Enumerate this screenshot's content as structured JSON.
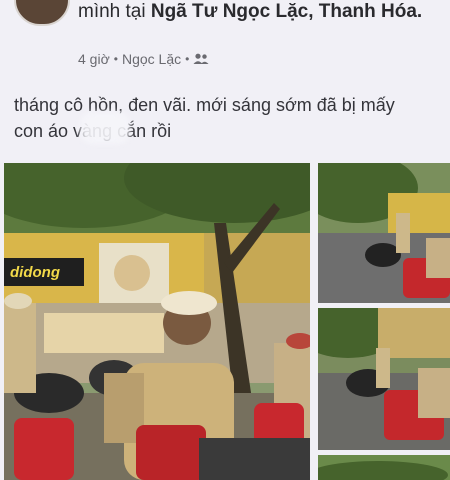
{
  "post": {
    "header_line1": "mình tại ",
    "location": "Ngã Tư Ngọc Lặc, Thanh Hóa.",
    "time": "4 giờ",
    "place": "Ngọc Lặc",
    "privacy_icon": "friends-icon",
    "text_line1": "tháng cô hồn, đen vãi. mới sáng sớm đã bị mấy",
    "text_line2": "con        áo vàng cắn rồi"
  },
  "photos": {
    "main_sign": "didong"
  }
}
